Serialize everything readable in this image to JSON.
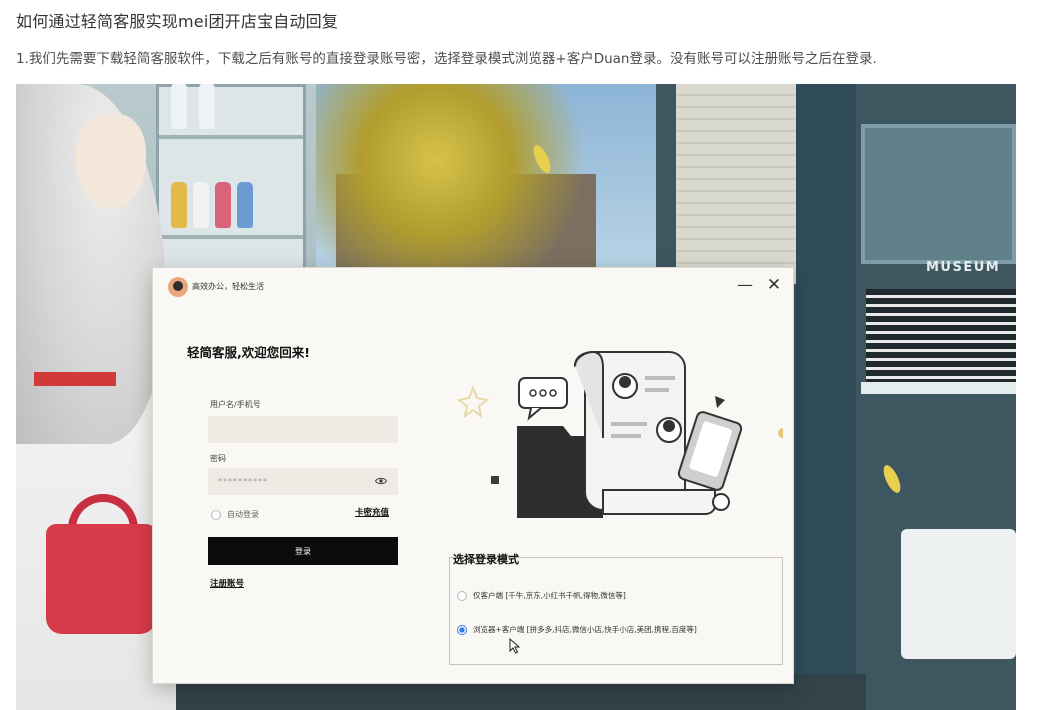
{
  "article": {
    "title": "如何通过轻简客服实现mei团开店宝自动回复",
    "step1": "1.我们先需要下载轻简客服软件，下载之后有账号的直接登录账号密，选择登录模式浏览器+客户Duan登录。没有账号可以注册账号之后在登录."
  },
  "background": {
    "museum_sign": "MUSEUM"
  },
  "app": {
    "slogan": "高效办公，轻松生活",
    "minimize_label": "—",
    "close_label": "✕",
    "welcome": "轻简客服,欢迎您回来!",
    "username_label": "用户名/手机号",
    "username_value": "",
    "password_label": "密码",
    "password_value": "**********",
    "remember_label": "自动登录",
    "recharge_label": "卡密充值",
    "login_label": "登录",
    "register_label": "注册账号",
    "mode_title": "选择登录模式",
    "mode_options": [
      {
        "label": "仅客户端  [千牛,京东,小红书千帆,得物,微信等]",
        "selected": false
      },
      {
        "label": "浏览器+客户端 [拼多多,抖店,微信小店,快手小店,美团,携程,百度等]",
        "selected": true
      }
    ],
    "accent_color": "#2f7de1"
  }
}
